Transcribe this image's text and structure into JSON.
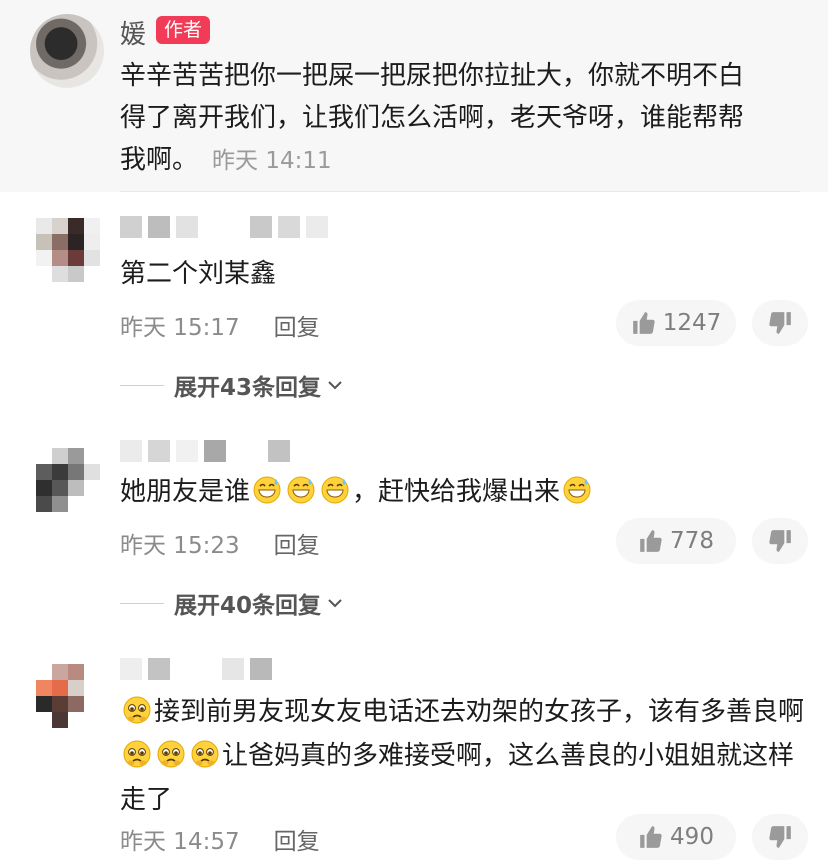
{
  "author_comment": {
    "name": "媛",
    "badge": "作者",
    "text": "辛辛苦苦把你一把屎一把尿把你拉扯大，你就不明不白得了离开我们，让我们怎么活啊，老天爷呀，谁能帮帮我啊。",
    "time": "昨天 14:11"
  },
  "comments": [
    {
      "text": "第二个刘某鑫",
      "time": "昨天 15:17",
      "reply_label": "回复",
      "likes": "1247",
      "expand_label": "展开43条回复"
    },
    {
      "text_a": "她朋友是谁",
      "text_b": "，赶快给我爆出来",
      "emoji": "grinning-sweat",
      "time": "昨天 15:23",
      "reply_label": "回复",
      "likes": "778",
      "expand_label": "展开40条回复"
    },
    {
      "text_a": "接到前男友现女友电话还去劝架的女孩子，该有多善良啊",
      "text_b": "让爸妈真的多难接受啊，这么善良的小姐姐就这样走了",
      "emoji": "pleading-face",
      "time": "昨天 14:57",
      "reply_label": "回复",
      "likes": "490"
    }
  ],
  "colors": {
    "badge": "#f23b56",
    "meta": "#8b8b8b",
    "pill": "#f6f6f6"
  }
}
